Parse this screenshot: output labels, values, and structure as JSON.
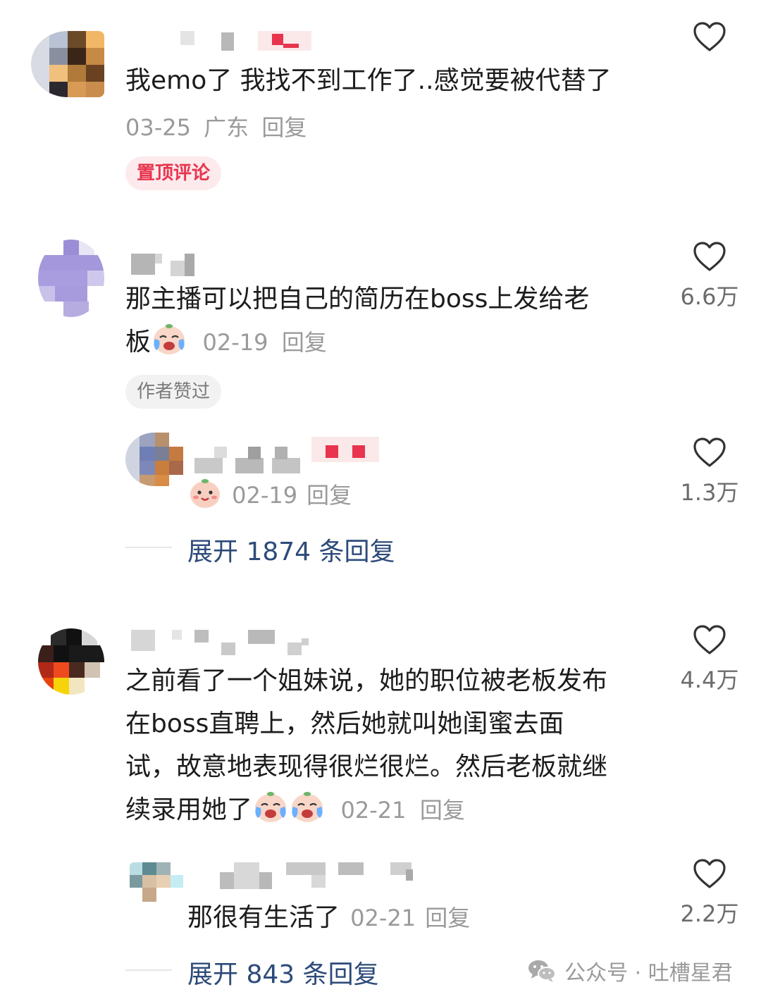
{
  "comments": [
    {
      "text": "我emo了 我找不到工作了..感觉要被代替了",
      "date": "03-25",
      "location": "广东",
      "reply_label": "回复",
      "badge": "置顶评论",
      "likes": ""
    },
    {
      "text_line1": "那主播可以把自己的简历在boss上发给老",
      "text_line2": "板",
      "date": "02-19",
      "reply_label": "回复",
      "badge": "作者赞过",
      "likes": "6.6万",
      "reply": {
        "date": "02-19",
        "reply_label": "回复",
        "likes": "1.3万"
      },
      "expand_label": "展开 1874 条回复"
    },
    {
      "text_line1": "之前看了一个姐妹说，她的职位被老板发布",
      "text_line2": "在boss直聘上，然后她就叫她闺蜜去面",
      "text_line3": "试，故意地表现得很烂很烂。然后老板就继",
      "text_line4": "续录用她了",
      "date": "02-21",
      "reply_label": "回复",
      "likes": "4.4万",
      "reply": {
        "text": "那很有生活了",
        "date": "02-21",
        "reply_label": "回复",
        "likes": "2.2万"
      },
      "expand_label": "展开 843 条回复"
    }
  ],
  "watermark": "公众号 · 吐槽星君",
  "icons": {
    "like": "heart-outline-icon",
    "emoji_cry": "crying-face-emoji",
    "emoji_smile": "smiling-face-emoji",
    "wechat": "wechat-icon"
  },
  "colors": {
    "pinned_badge_bg": "#fdeaec",
    "pinned_badge_text": "#e8344e",
    "author_badge_bg": "#f2f2f2",
    "author_badge_text": "#7a7a7a",
    "expand_text": "#2d4b7a",
    "meta_text": "#9a9a9a"
  }
}
